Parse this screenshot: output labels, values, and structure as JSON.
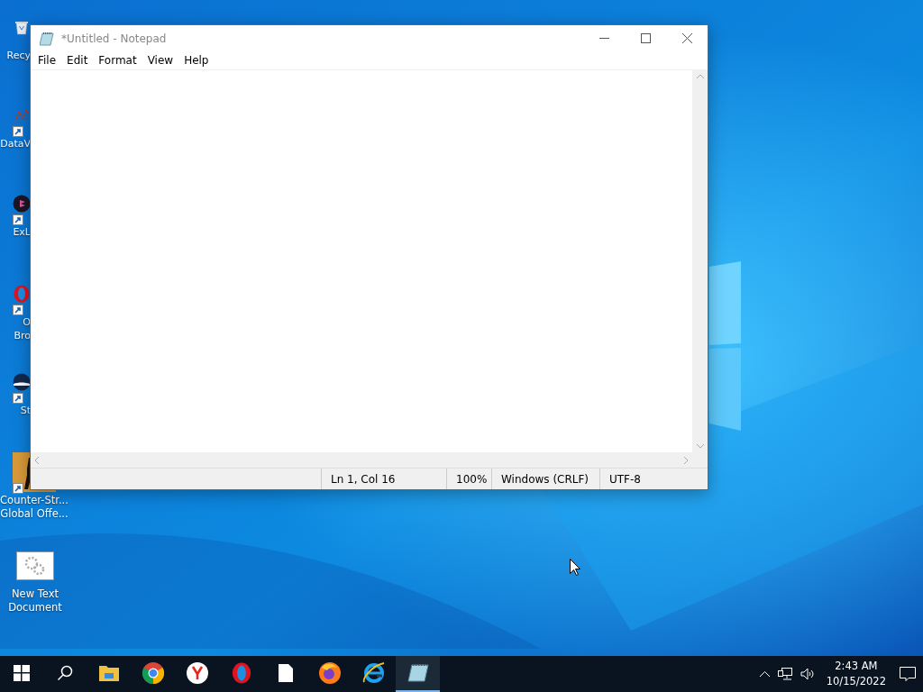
{
  "desktop_icons": [
    {
      "kind": "recycle",
      "lines": [
        "Recy"
      ],
      "shortcut": false,
      "cut": true
    },
    {
      "kind": "chart",
      "lines": [
        "DataV"
      ],
      "shortcut": true,
      "cut": true
    },
    {
      "kind": "dark",
      "lines": [
        "ExL"
      ],
      "shortcut": true,
      "cut": true
    },
    {
      "kind": "opera",
      "lines": [
        "O",
        "Bro"
      ],
      "shortcut": true,
      "cut": true
    },
    {
      "kind": "steam",
      "lines": [
        "St"
      ],
      "shortcut": true,
      "cut": true
    },
    {
      "kind": "game",
      "lines": [
        "Counter-Str...",
        "Global Offe..."
      ],
      "shortcut": true,
      "cut": false
    },
    {
      "kind": "textdoc",
      "lines": [
        "New Text",
        "Document"
      ],
      "shortcut": false,
      "cut": false
    }
  ],
  "window": {
    "title": "*Untitled - Notepad",
    "menu": [
      "File",
      "Edit",
      "Format",
      "View",
      "Help"
    ],
    "status_bar": [
      "Ln 1, Col 16",
      "100%",
      "Windows (CRLF)",
      "UTF-8"
    ]
  },
  "taskbar": {
    "apps": [
      {
        "kind": "start",
        "selected": false
      },
      {
        "kind": "search",
        "selected": false
      },
      {
        "kind": "explorer",
        "selected": false
      },
      {
        "kind": "chrome",
        "selected": false
      },
      {
        "kind": "yandex",
        "selected": false
      },
      {
        "kind": "opera",
        "selected": false
      },
      {
        "kind": "file",
        "selected": false
      },
      {
        "kind": "firefox",
        "selected": false
      },
      {
        "kind": "ie",
        "selected": false
      },
      {
        "kind": "notepad",
        "selected": true
      }
    ],
    "time": "2:43 AM",
    "date": "10/15/2022"
  }
}
